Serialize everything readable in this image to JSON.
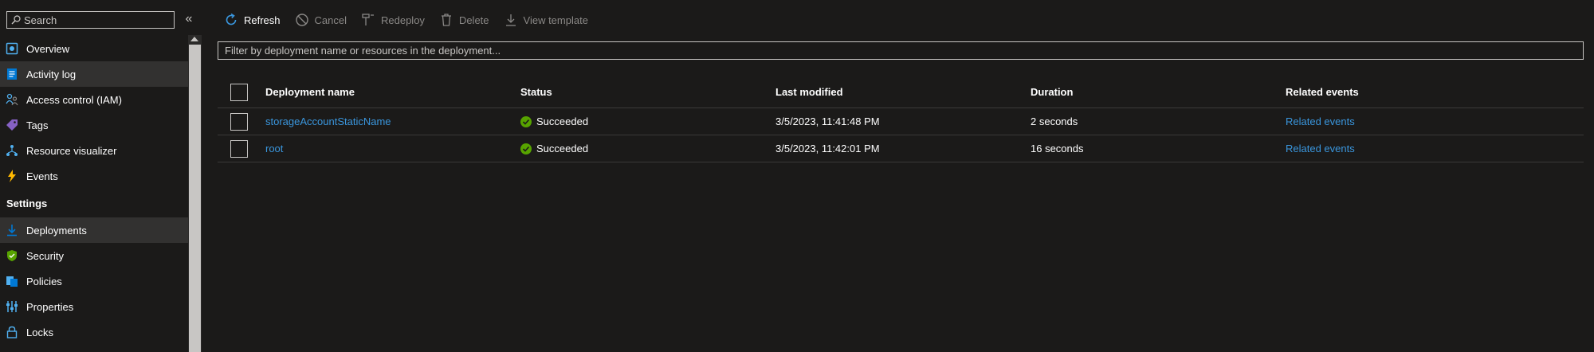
{
  "sidebar": {
    "search_placeholder": "Search",
    "collapse_glyph": "«",
    "items_top": [
      {
        "label": "Overview",
        "icon": "overview-icon"
      },
      {
        "label": "Activity log",
        "icon": "activity-log-icon"
      },
      {
        "label": "Access control (IAM)",
        "icon": "people-icon"
      },
      {
        "label": "Tags",
        "icon": "tag-icon"
      },
      {
        "label": "Resource visualizer",
        "icon": "hierarchy-icon"
      },
      {
        "label": "Events",
        "icon": "lightning-icon"
      }
    ],
    "section_settings": "Settings",
    "items_settings": [
      {
        "label": "Deployments",
        "icon": "deployments-icon"
      },
      {
        "label": "Security",
        "icon": "shield-icon"
      },
      {
        "label": "Policies",
        "icon": "policies-icon"
      },
      {
        "label": "Properties",
        "icon": "properties-icon"
      },
      {
        "label": "Locks",
        "icon": "lock-icon"
      }
    ]
  },
  "toolbar": {
    "refresh": "Refresh",
    "cancel": "Cancel",
    "redeploy": "Redeploy",
    "delete": "Delete",
    "view_template": "View template"
  },
  "filter": {
    "placeholder": "Filter by deployment name or resources in the deployment..."
  },
  "table": {
    "headers": {
      "name": "Deployment name",
      "status": "Status",
      "modified": "Last modified",
      "duration": "Duration",
      "related": "Related events"
    },
    "rows": [
      {
        "name": "storageAccountStaticName",
        "status": "Succeeded",
        "modified": "3/5/2023, 11:41:48 PM",
        "duration": "2 seconds",
        "related": "Related events"
      },
      {
        "name": "root",
        "status": "Succeeded",
        "modified": "3/5/2023, 11:42:01 PM",
        "duration": "16 seconds",
        "related": "Related events"
      }
    ]
  },
  "colors": {
    "background": "#1b1a19",
    "accent_link": "#3a96dd",
    "success": "#57a300",
    "active_item": "#323130"
  }
}
